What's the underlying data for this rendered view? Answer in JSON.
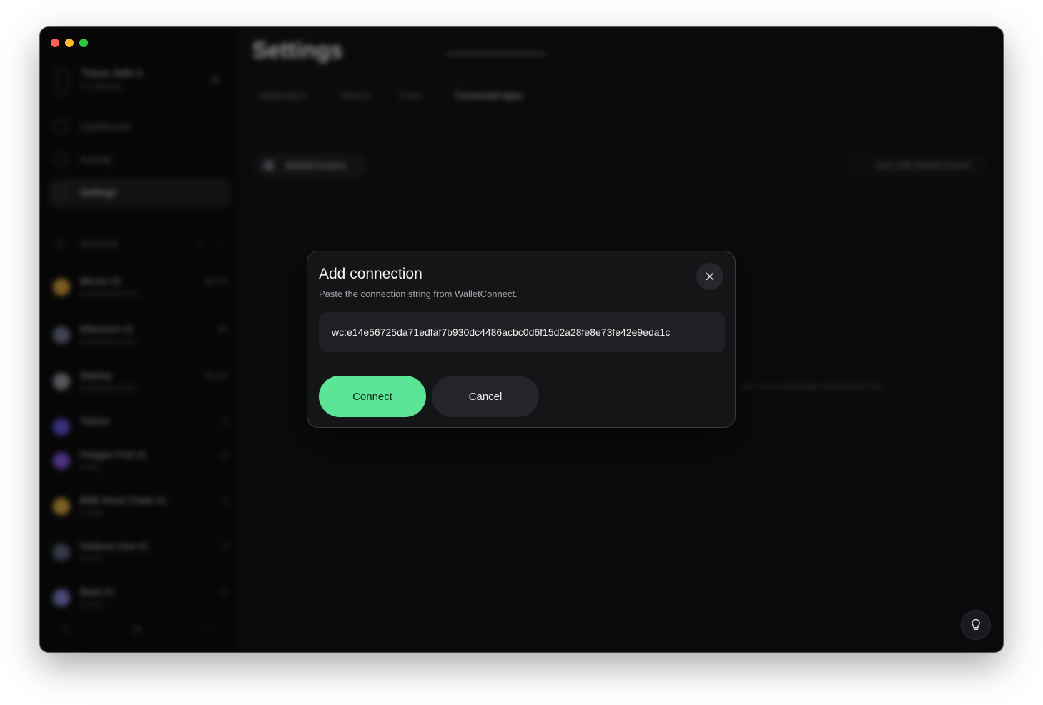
{
  "window": {
    "controls": [
      "close",
      "minimize",
      "zoom"
    ]
  },
  "sidebar": {
    "account": {
      "name": "Trezor Safe 3",
      "sub": "0.1 Bitcoin",
      "gear_icon": "gear-icon"
    },
    "nav": [
      {
        "label": "Dashboard",
        "icon": "dashboard-icon",
        "active": false
      },
      {
        "label": "Activity",
        "icon": "activity-icon",
        "active": false
      },
      {
        "label": "Settings",
        "icon": "settings-icon",
        "active": true
      }
    ],
    "accounts_header": {
      "label": "Accounts",
      "action_a": "+",
      "action_b": "⋯"
    },
    "accounts": [
      {
        "name": "Bitcoin #1",
        "sub": "0.00123456 BTC",
        "value": "$0.00",
        "coin_color": "#c9953a"
      },
      {
        "name": "Ethereum #1",
        "sub": "0.0000000 ETH",
        "value": "$0",
        "coin_color": "#6c6e86"
      },
      {
        "name": "Staking",
        "sub": "0.0000000 ETH",
        "value": "$0.00",
        "coin_color": "#8a8b90"
      },
      {
        "name": "Tokens",
        "sub": "",
        "value": "0",
        "coin_color": "#5d4fc9"
      },
      {
        "name": "Polygon PoS #1",
        "sub": "0 POL",
        "value": "0",
        "coin_color": "#7a4fd0"
      },
      {
        "name": "BNB Smart Chain #1",
        "sub": "0 BNB",
        "value": "0",
        "coin_color": "#c99a3a"
      },
      {
        "name": "Arbitrum One #1",
        "sub": "0 ETH",
        "value": "0",
        "coin_color": "#595d75"
      },
      {
        "name": "Base #1",
        "sub": "0 ETH",
        "value": "0",
        "coin_color": "#7a78c0"
      }
    ],
    "footer": [
      "✎",
      "⚙",
      "⋯"
    ]
  },
  "main": {
    "title": "Settings",
    "tabs": [
      "Application",
      "Device",
      "Coins",
      "Connected apps"
    ],
    "active_tab": "Connected apps",
    "walletconnect_label": "WalletConnect",
    "sync_label": "Sync with WalletConnect",
    "hint": "your connected dapps will appear here"
  },
  "dialog": {
    "title": "Add connection",
    "subtitle": "Paste the connection string from WalletConnect.",
    "input_value": "wc:e14e56725da71edfaf7b930dc4486acbc0d6f15d2a28fe8e73fe42e9eda1c",
    "connect_label": "Connect",
    "cancel_label": "Cancel",
    "close_icon": "close-icon"
  },
  "help": {
    "icon": "lightbulb-icon"
  },
  "colors": {
    "accent": "#5ce597",
    "background": "#101113",
    "dialog": "#141517"
  }
}
